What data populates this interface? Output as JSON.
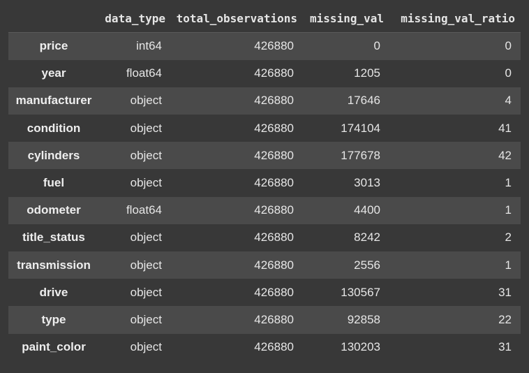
{
  "table": {
    "columns": [
      "data_type",
      "total_observations",
      "missing_val",
      "missing_val_ratio"
    ],
    "rows": [
      {
        "index": "price",
        "data_type": "int64",
        "total_observations": "426880",
        "missing_val": "0",
        "missing_val_ratio": "0"
      },
      {
        "index": "year",
        "data_type": "float64",
        "total_observations": "426880",
        "missing_val": "1205",
        "missing_val_ratio": "0"
      },
      {
        "index": "manufacturer",
        "data_type": "object",
        "total_observations": "426880",
        "missing_val": "17646",
        "missing_val_ratio": "4"
      },
      {
        "index": "condition",
        "data_type": "object",
        "total_observations": "426880",
        "missing_val": "174104",
        "missing_val_ratio": "41"
      },
      {
        "index": "cylinders",
        "data_type": "object",
        "total_observations": "426880",
        "missing_val": "177678",
        "missing_val_ratio": "42"
      },
      {
        "index": "fuel",
        "data_type": "object",
        "total_observations": "426880",
        "missing_val": "3013",
        "missing_val_ratio": "1"
      },
      {
        "index": "odometer",
        "data_type": "float64",
        "total_observations": "426880",
        "missing_val": "4400",
        "missing_val_ratio": "1"
      },
      {
        "index": "title_status",
        "data_type": "object",
        "total_observations": "426880",
        "missing_val": "8242",
        "missing_val_ratio": "2"
      },
      {
        "index": "transmission",
        "data_type": "object",
        "total_observations": "426880",
        "missing_val": "2556",
        "missing_val_ratio": "1"
      },
      {
        "index": "drive",
        "data_type": "object",
        "total_observations": "426880",
        "missing_val": "130567",
        "missing_val_ratio": "31"
      },
      {
        "index": "type",
        "data_type": "object",
        "total_observations": "426880",
        "missing_val": "92858",
        "missing_val_ratio": "22"
      },
      {
        "index": "paint_color",
        "data_type": "object",
        "total_observations": "426880",
        "missing_val": "130203",
        "missing_val_ratio": "31"
      }
    ]
  },
  "colors": {
    "background": "#383838",
    "row_stripe": "#4a4a4a",
    "text": "#e6e6e6"
  }
}
